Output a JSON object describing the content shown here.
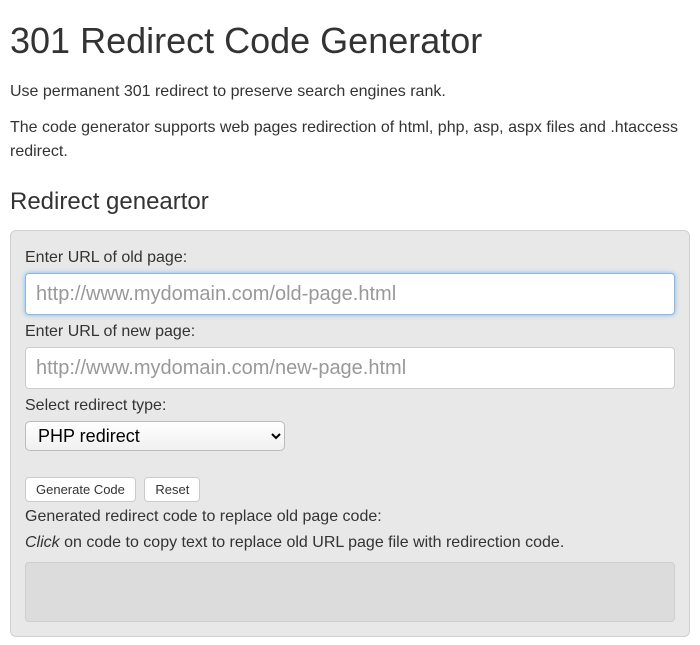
{
  "page": {
    "title": "301 Redirect Code Generator",
    "intro1": "Use permanent 301 redirect to preserve search engines rank.",
    "intro2": "The code generator supports web pages redirection of html, php, asp, aspx files and .htaccess redirect."
  },
  "section": {
    "heading": "Redirect geneartor"
  },
  "form": {
    "old_url_label": "Enter URL of old page:",
    "old_url_placeholder": "http://www.mydomain.com/old-page.html",
    "old_url_value": "",
    "new_url_label": "Enter URL of new page:",
    "new_url_placeholder": "http://www.mydomain.com/new-page.html",
    "new_url_value": "",
    "type_label": "Select redirect type:",
    "type_selected": "PHP redirect",
    "generate_label": "Generate Code",
    "reset_label": "Reset",
    "generated_label": "Generated redirect code to replace old page code:",
    "hint_emphasis": "Click",
    "hint_rest": " on code to copy text to replace old URL page file with redirection code."
  }
}
